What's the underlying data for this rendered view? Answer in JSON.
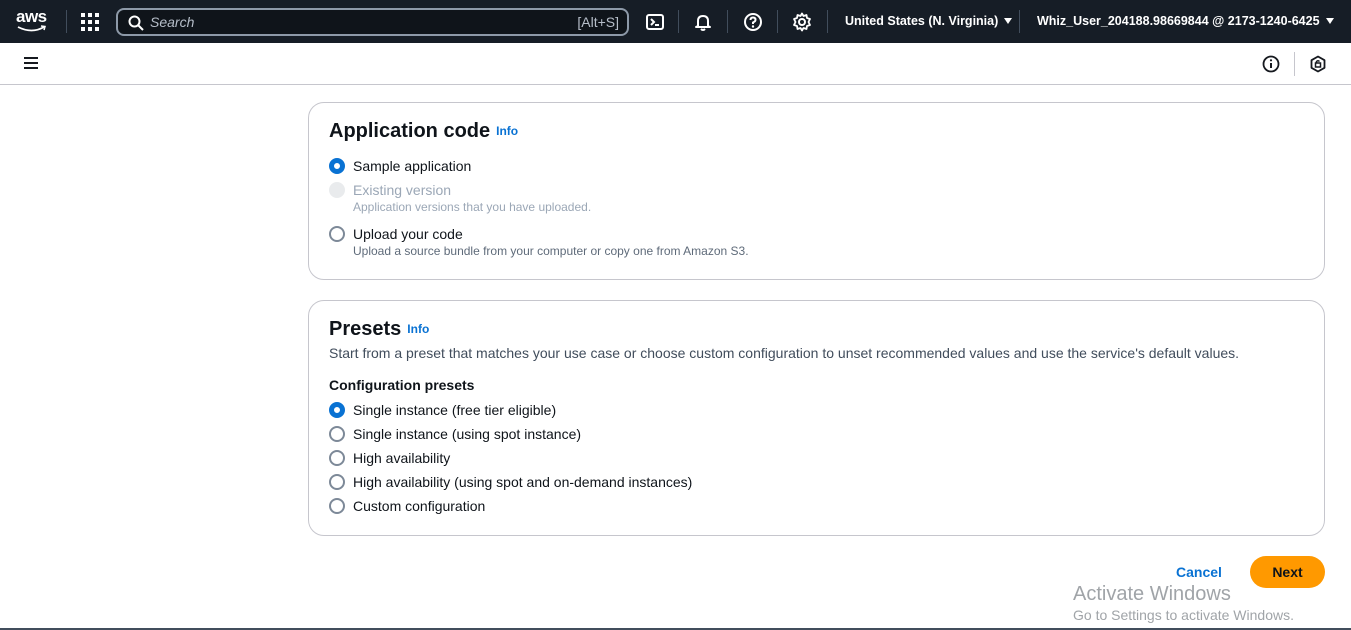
{
  "topnav": {
    "logo_text": "aws",
    "search_placeholder": "Search",
    "search_shortcut": "[Alt+S]",
    "region": "United States (N. Virginia)",
    "user": "Whiz_User_204188.98669844 @ 2173-1240-6425"
  },
  "application_code": {
    "title": "Application code",
    "info": "Info",
    "options": [
      {
        "label": "Sample application",
        "description": "",
        "state": "checked"
      },
      {
        "label": "Existing version",
        "description": "Application versions that you have uploaded.",
        "state": "disabled"
      },
      {
        "label": "Upload your code",
        "description": "Upload a source bundle from your computer or copy one from Amazon S3.",
        "state": "unchecked"
      }
    ]
  },
  "presets": {
    "title": "Presets",
    "info": "Info",
    "description": "Start from a preset that matches your use case or choose custom configuration to unset recommended values and use the service's default values.",
    "group_label": "Configuration presets",
    "options": [
      {
        "label": "Single instance (free tier eligible)",
        "state": "checked"
      },
      {
        "label": "Single instance (using spot instance)",
        "state": "unchecked"
      },
      {
        "label": "High availability",
        "state": "unchecked"
      },
      {
        "label": "High availability (using spot and on-demand instances)",
        "state": "unchecked"
      },
      {
        "label": "Custom configuration",
        "state": "unchecked"
      }
    ]
  },
  "actions": {
    "cancel": "Cancel",
    "next": "Next"
  },
  "watermark": {
    "line1": "Activate Windows",
    "line2": "Go to Settings to activate Windows."
  },
  "colors": {
    "nav_bg": "#161d26",
    "link": "#0972d3",
    "primary_button": "#ff9900",
    "radio_checked": "#0972d3"
  },
  "icons": [
    "aws-logo",
    "app-grid-icon",
    "search-icon",
    "cloudshell-icon",
    "bell-icon",
    "help-icon",
    "gear-icon",
    "menu-icon",
    "info-icon",
    "unlock-icon"
  ]
}
